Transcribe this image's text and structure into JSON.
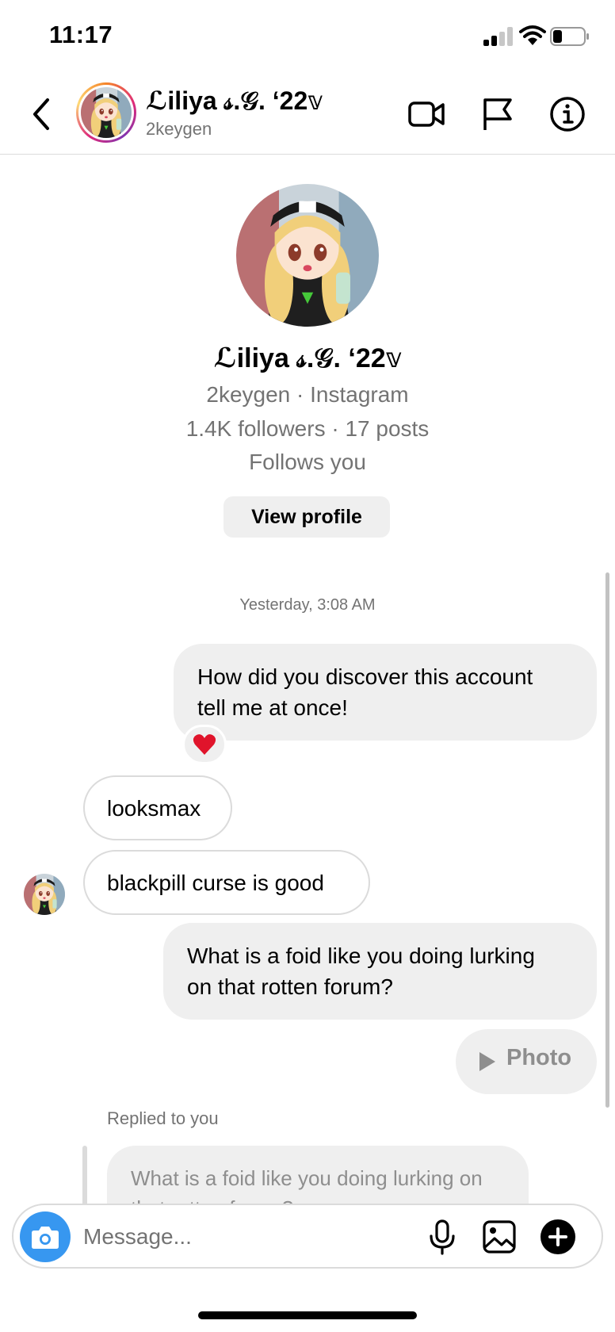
{
  "status_bar": {
    "time": "11:17"
  },
  "header": {
    "display_name": "ℒiliya 𝓈.𝒢. ‘22𝕧",
    "username": "2keygen",
    "icons": [
      "back-arrow-icon",
      "video-call-icon",
      "flag-icon",
      "info-icon"
    ]
  },
  "profile_card": {
    "display_name": "ℒiliya 𝓈.𝒢. ‘22𝕧",
    "subtitle": "2keygen · Instagram",
    "stats": "1.4K followers · 17 posts",
    "relationship": "Follows you",
    "view_profile_label": "View profile"
  },
  "conversation": {
    "timestamp": "Yesterday, 3:08 AM",
    "messages": [
      {
        "from": "me",
        "lines": [
          "How did you discover this account",
          "tell me at once!"
        ],
        "reaction": "❤️"
      },
      {
        "from": "them",
        "text": "looksmax"
      },
      {
        "from": "them",
        "text": "blackpill curse is good"
      },
      {
        "from": "me",
        "lines": [
          "What is a foid like you doing lurking",
          "on that rotten forum?"
        ]
      },
      {
        "from": "me",
        "type": "photo",
        "text": "Photo"
      },
      {
        "from": "them",
        "replied_label": "Replied to you",
        "quoted_lines": [
          "What is a foid like you doing lurking on",
          "that rotten forum?"
        ]
      }
    ]
  },
  "composer": {
    "placeholder": "Message...",
    "icons": [
      "camera-icon",
      "microphone-icon",
      "gallery-icon",
      "plus-icon"
    ]
  },
  "colors": {
    "accent_blue": "#3797f0",
    "bubble_gray": "#efefef",
    "secondary_text": "#737373"
  }
}
